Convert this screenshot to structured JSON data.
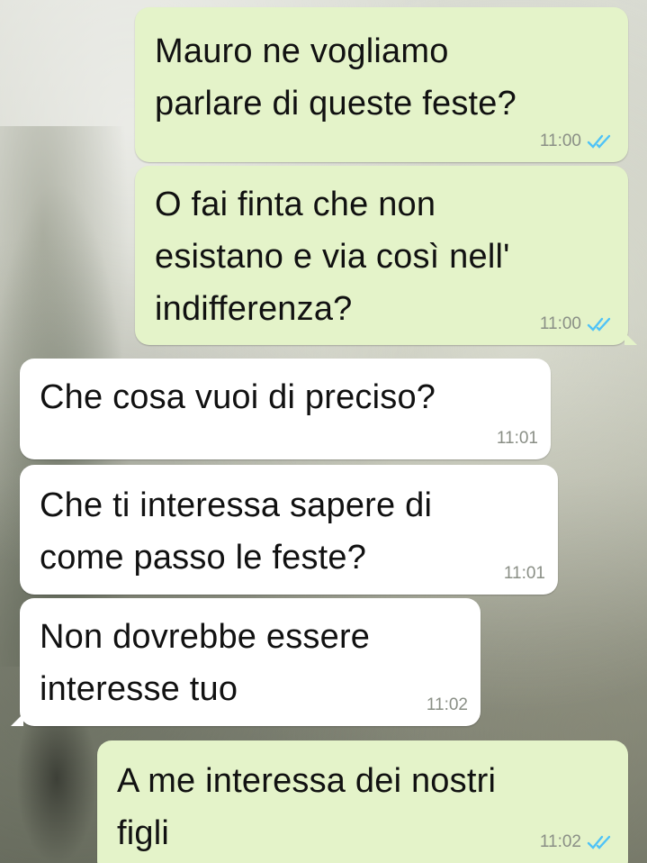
{
  "messages": [
    {
      "text": "Mauro ne vogliamo\nparlare di queste feste?",
      "time": "11:00",
      "direction": "outgoing",
      "read": true
    },
    {
      "text": "O fai finta che non\nesistano e via così nell'\nindifferenza?",
      "time": "11:00",
      "direction": "outgoing",
      "read": true
    },
    {
      "text": "Che cosa vuoi di preciso?",
      "time": "11:01",
      "direction": "incoming"
    },
    {
      "text": "Che ti interessa sapere di\ncome passo le feste?",
      "time": "11:01",
      "direction": "incoming"
    },
    {
      "text": "Non dovrebbe essere\ninteresse tuo",
      "time": "11:02",
      "direction": "incoming"
    },
    {
      "text": "A me interessa dei nostri\nfigli",
      "time": "11:02",
      "direction": "outgoing",
      "read": true
    }
  ],
  "colors": {
    "outgoing_bubble": "#e4f3c9",
    "incoming_bubble": "#ffffff",
    "read_ticks": "#4fc3f7"
  }
}
